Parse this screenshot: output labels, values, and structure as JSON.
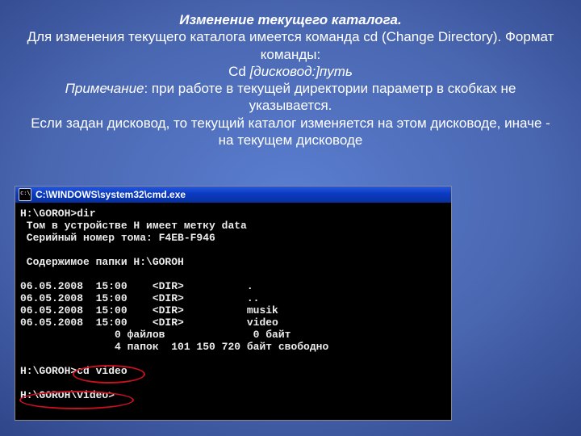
{
  "heading": "Изменение текущего каталога.",
  "para1a": "Для изменения текущего каталога имеется команда cd (Change Directory). Формат команды:",
  "cdline_cmd": "Cd ",
  "cdline_arg": "[дисковод:]путь",
  "para2_lead": "Примечание",
  "para2_rest": ": при работе в текущей директории параметр в скобках не указывается.",
  "para3": "Если задан дисковод, то текущий каталог изменяется на этом дисководе, иначе - на текущем дисководе",
  "titlebar": "C:\\WINDOWS\\system32\\cmd.exe",
  "terminal_text": "H:\\GOROH>dir\n Том в устройстве H имеет метку data\n Серийный номер тома: F4EB-F946\n\n Содержимое папки H:\\GOROH\n\n06.05.2008  15:00    <DIR>          .\n06.05.2008  15:00    <DIR>          ..\n06.05.2008  15:00    <DIR>          musik\n06.05.2008  15:00    <DIR>          video\n               0 файлов              0 байт\n               4 папок  101 150 720 байт свободно\n\nH:\\GOROH>cd video\n\nH:\\GOROH\\video>"
}
